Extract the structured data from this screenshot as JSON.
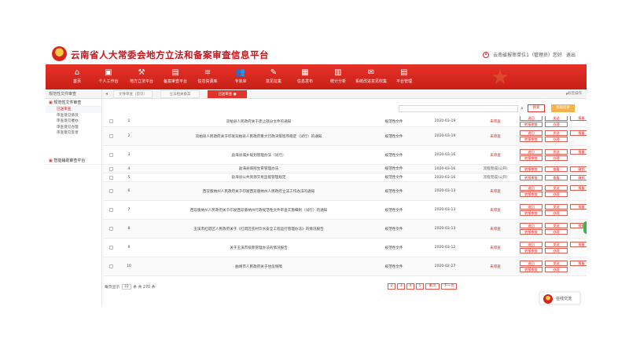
{
  "header": {
    "site_title": "云南省人大常委会地方立法和备案审查信息平台",
    "user_text": "云南省报审单位1（管理员）您好",
    "logout": "退出"
  },
  "nav": {
    "items": [
      {
        "label": "首页",
        "icon": "home-icon",
        "glyph": "⌂"
      },
      {
        "label": "个人工作台",
        "icon": "workbench-icon",
        "glyph": "▣"
      },
      {
        "label": "地方立法平台",
        "icon": "gavel-icon",
        "glyph": "⚒"
      },
      {
        "label": "备案审查平台",
        "icon": "review-icon",
        "glyph": "▤"
      },
      {
        "label": "信息资源库",
        "icon": "database-icon",
        "glyph": "≋"
      },
      {
        "label": "专家库",
        "icon": "experts-icon",
        "glyph": "👥"
      },
      {
        "label": "意见征集",
        "icon": "edit-icon",
        "glyph": "✎"
      },
      {
        "label": "信息发布",
        "icon": "publish-icon",
        "glyph": "▦"
      },
      {
        "label": "统计分析",
        "icon": "chart-icon",
        "glyph": "▥"
      },
      {
        "label": "系统改进意见收集",
        "icon": "feedback-icon",
        "glyph": "✉"
      },
      {
        "label": "平台管理",
        "icon": "manage-icon",
        "glyph": "▤"
      }
    ]
  },
  "tabbar": {
    "sidebar_head": "规范性文件审查",
    "tabs": [
      "文件审查（首页）",
      "立法相关备案",
      "已送审查 ●"
    ],
    "ops": "标签操作"
  },
  "sidebar": {
    "groups": [
      {
        "label": "规范性文件审查",
        "items": [
          "已送审查",
          "审查意见情况",
          "审查意见催办",
          "审查意见办理",
          "审查意见反馈"
        ]
      },
      {
        "label": "智能辅助审查平台",
        "items": []
      }
    ],
    "active_item": "已送审查"
  },
  "toolbar": {
    "search_placeholder": "",
    "search_btn": "搜索",
    "advanced_btn": "高级检索"
  },
  "table": {
    "rows": [
      {
        "num": "1",
        "title": "双柏县人民政府关于废止部分文件的通知",
        "type": "规范性文件",
        "date": "2020-03-19",
        "status": "未审查",
        "status_color": "red",
        "ops": [
          "退回",
          "发送",
          "报备",
          "转报审查",
          "办理"
        ]
      },
      {
        "num": "2",
        "title": "双柏县人民政府关于印发双柏县人民政府重大行政决策程序规定（试行）的通知",
        "type": "规范性文件",
        "date": "2020-03-19",
        "status": "未审查",
        "status_color": "red",
        "ops": [
          "退回",
          "发送",
          "报备",
          "转报审查",
          "办理"
        ]
      },
      {
        "num": "3",
        "title": "勐海县城乡规划管理办法（试行）",
        "type": "规范性文件",
        "date": "2020-03-16",
        "status": "未审查",
        "status_color": "red",
        "ops": [
          "退回",
          "发送",
          "报备",
          "转报审查",
          "办理"
        ]
      },
      {
        "num": "4",
        "title": "勐海县病残生育管理办法",
        "type": "规范性文件",
        "date": "2020-03-16",
        "status": "流程完成(公开)",
        "status_color": "gray",
        "ops": [
          "转报审查",
          "查看",
          "撤销"
        ]
      },
      {
        "num": "5",
        "title": "勐海县公共资源交易监督管理规定",
        "type": "规范性文件",
        "date": "2020-03-16",
        "status": "流程完成(公开)",
        "status_color": "gray",
        "ops": [
          "转报审查",
          "查看",
          "撤销"
        ]
      },
      {
        "num": "6",
        "title": "西双版纳州人民政府关于印发西双版纳州人民政府立法工作办法的通知",
        "type": "规范性文件",
        "date": "2020-03-13",
        "status": "未审查",
        "status_color": "red",
        "ops": [
          "退回",
          "发送",
          "报备",
          "转报审查",
          "办理"
        ]
      },
      {
        "num": "7",
        "title": "西双版纳州人民政府关于印发西双版纳州行政规范性文件审查实施细则（试行）的通知",
        "type": "规范性文件",
        "date": "2020-03-13",
        "status": "未审查",
        "status_color": "red",
        "ops": [
          "退回",
          "发送",
          "报备",
          "转报审查",
          "办理"
        ]
      },
      {
        "num": "8",
        "title": "玉溪市红塔区人民政府关于《红塔区农村饮水安全工程运行管理办法》的情况报告",
        "type": "规范性文件",
        "date": "2020-03-13",
        "status": "未审查",
        "status_color": "red",
        "ops": [
          "退回",
          "发送",
          "报备",
          "转报审查",
          "办理"
        ]
      },
      {
        "num": "9",
        "title": "关于玉溪市殡葬管理办法的情况报告",
        "type": "规范性文件",
        "date": "2020-03-12",
        "status": "未审查",
        "status_color": "red",
        "ops": [
          "退回",
          "发送",
          "报备",
          "转报审查",
          "办理"
        ]
      },
      {
        "num": "10",
        "title": "曲靖市人民政府关于住房保障",
        "type": "规范性文件",
        "date": "2020-02-27",
        "status": "未审查",
        "status_color": "red",
        "ops": [
          "退回",
          "发送",
          "报备",
          "转报审查",
          "办理"
        ]
      }
    ]
  },
  "pager": {
    "prefix": "每页显示",
    "size": "10",
    "suffix": "条 共 270 条",
    "pages": [
      "2",
      "3",
      "4",
      "5",
      "尾页",
      "下一页"
    ]
  },
  "service": {
    "label": "在线交流"
  }
}
